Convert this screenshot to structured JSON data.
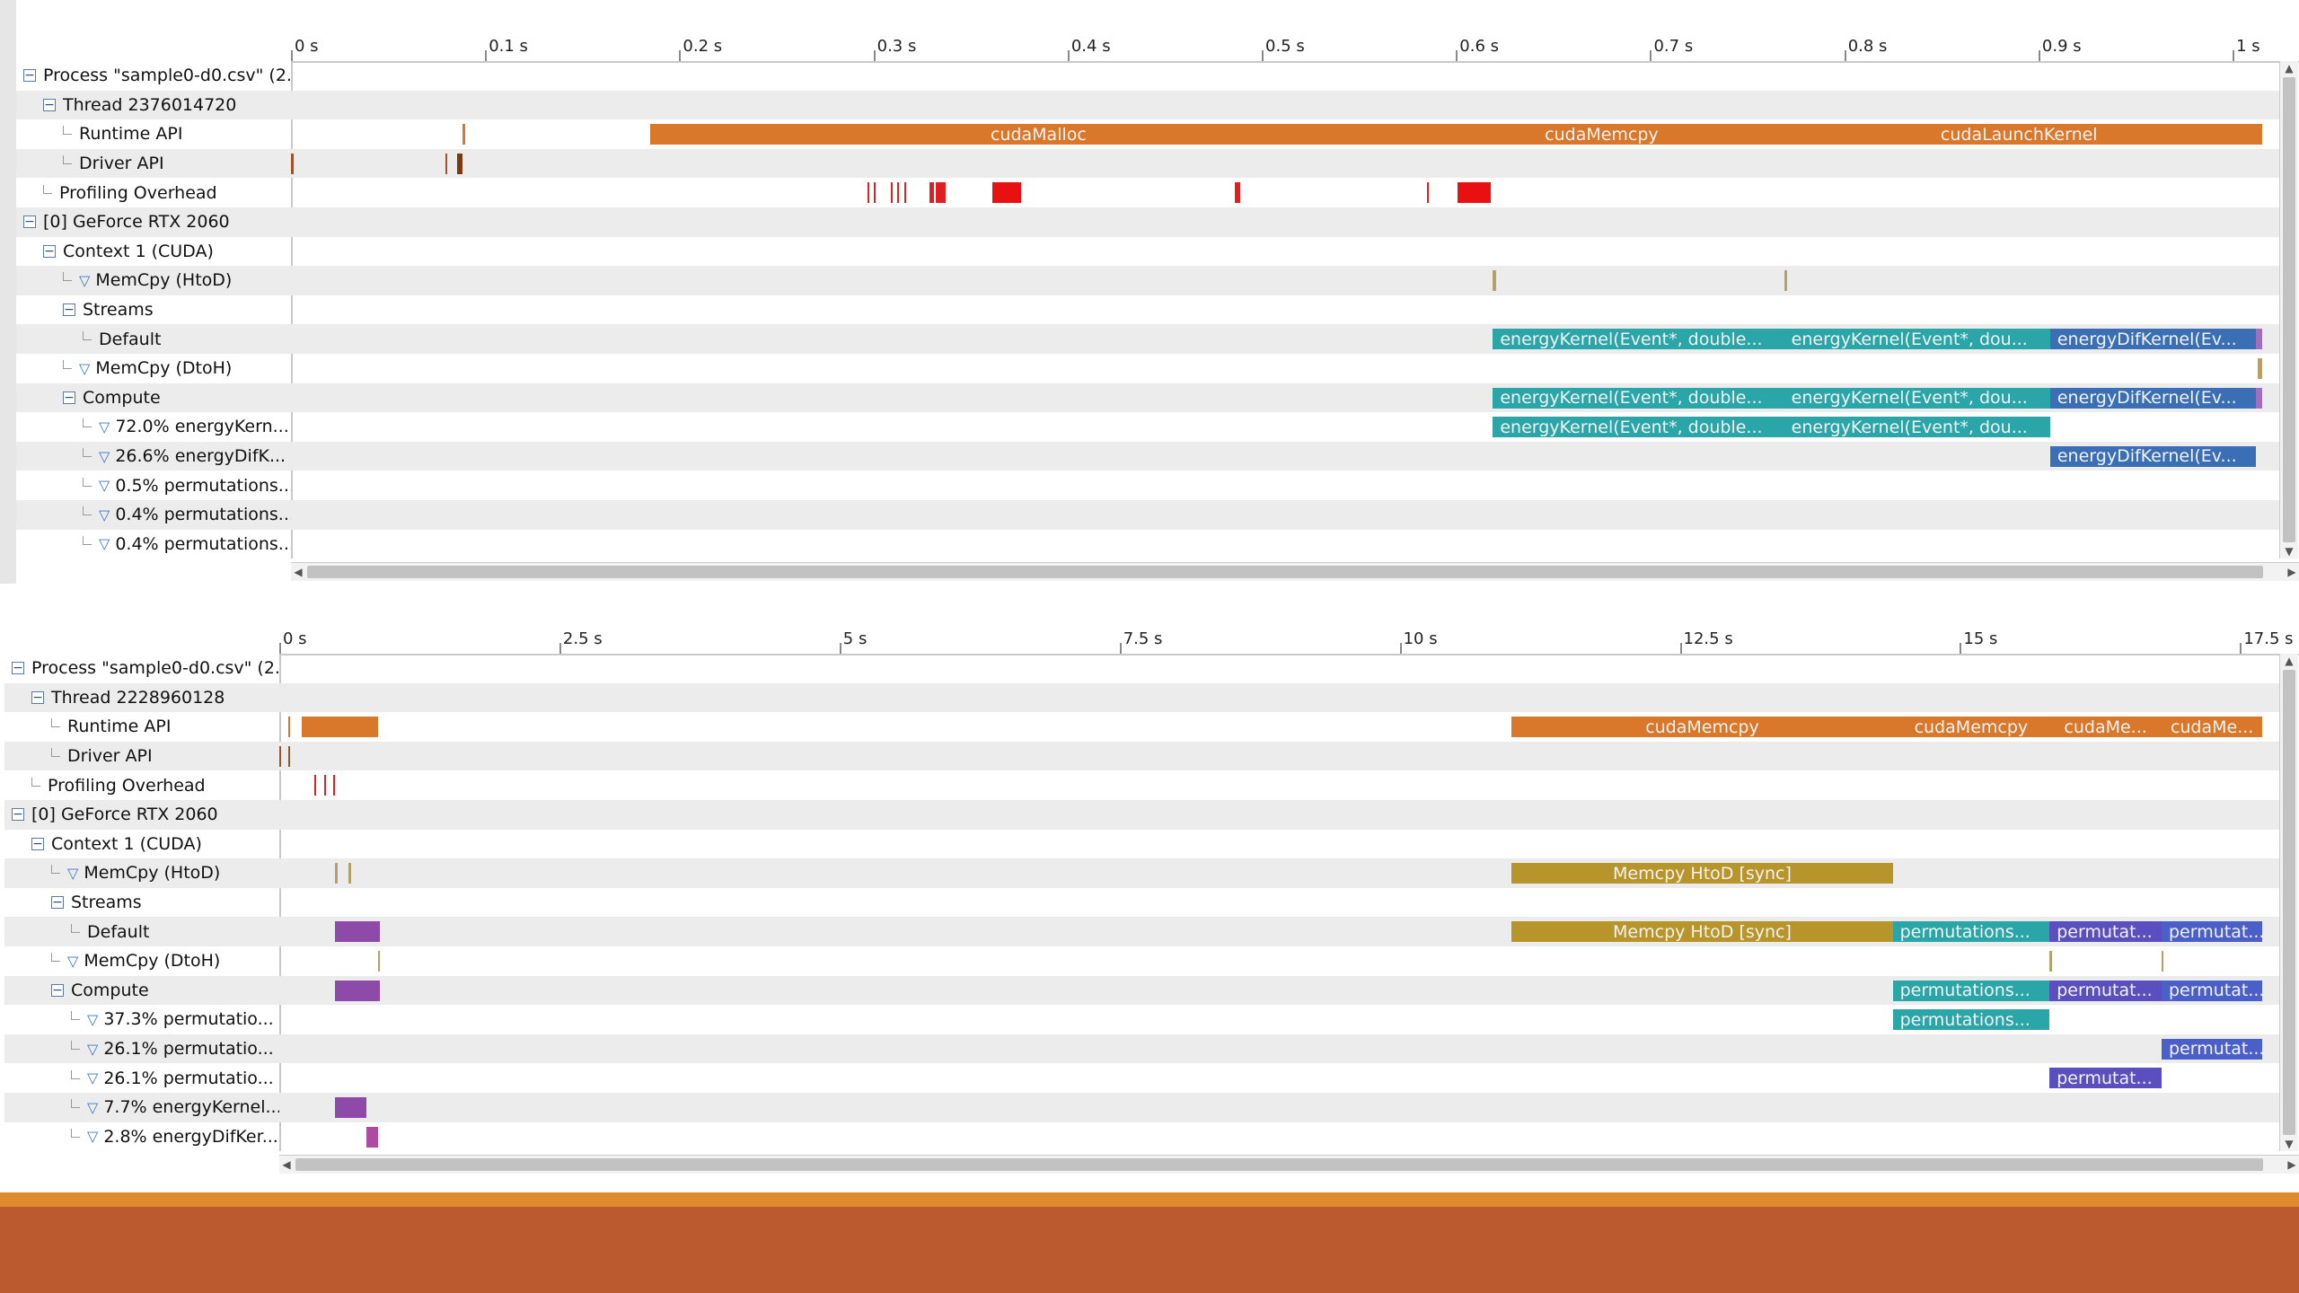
{
  "top_panel": {
    "ticks": [
      "0 s",
      "0.1 s",
      "0.2 s",
      "0.3 s",
      "0.4 s",
      "0.5 s",
      "0.6 s",
      "0.7 s",
      "0.8 s",
      "0.9 s",
      "1 s"
    ],
    "rows": [
      {
        "label": "Process \"sample0-d0.csv\" (2...",
        "indent": 0,
        "kind": "minus"
      },
      {
        "label": "Thread 2376014720",
        "indent": 1,
        "kind": "minus"
      },
      {
        "label": "Runtime API",
        "indent": 2,
        "kind": "leaf"
      },
      {
        "label": "Driver API",
        "indent": 2,
        "kind": "leaf"
      },
      {
        "label": "Profiling Overhead",
        "indent": 1,
        "kind": "leaf"
      },
      {
        "label": "[0] GeForce RTX 2060",
        "indent": 0,
        "kind": "minus"
      },
      {
        "label": "Context 1 (CUDA)",
        "indent": 1,
        "kind": "minus"
      },
      {
        "label": "MemCpy (HtoD)",
        "indent": 2,
        "kind": "filter"
      },
      {
        "label": "Streams",
        "indent": 2,
        "kind": "minus"
      },
      {
        "label": "Default",
        "indent": 3,
        "kind": "leaf"
      },
      {
        "label": "MemCpy (DtoH)",
        "indent": 2,
        "kind": "filter"
      },
      {
        "label": "Compute",
        "indent": 2,
        "kind": "minus"
      },
      {
        "label": "72.0% energyKern...",
        "indent": 3,
        "kind": "filter"
      },
      {
        "label": "26.6% energyDifK...",
        "indent": 3,
        "kind": "filter"
      },
      {
        "label": "0.5% permutations...",
        "indent": 3,
        "kind": "filter"
      },
      {
        "label": "0.4% permutations...",
        "indent": 3,
        "kind": "filter"
      },
      {
        "label": "0.4% permutations...",
        "indent": 3,
        "kind": "filter"
      }
    ],
    "bars": [
      {
        "row": 2,
        "start": 0.185,
        "end": 0.585,
        "label": "cudaMalloc",
        "color": "#d9782a"
      },
      {
        "row": 2,
        "start": 0.585,
        "end": 0.765,
        "label": "cudaMemcpy",
        "color": "#d9782a"
      },
      {
        "row": 2,
        "start": 0.765,
        "end": 1.015,
        "label": "cudaLaunchKernel",
        "color": "#d9782a"
      },
      {
        "row": 2,
        "start": 0.0885,
        "end": 0.0895,
        "label": "",
        "color": "#d9782a"
      },
      {
        "row": 3,
        "start": 0.0,
        "end": 0.0012,
        "label": "",
        "color": "#a0522d"
      },
      {
        "row": 3,
        "start": 0.0795,
        "end": 0.0805,
        "label": "",
        "color": "#a0522d"
      },
      {
        "row": 3,
        "start": 0.0855,
        "end": 0.0885,
        "label": "",
        "color": "#7a3a12"
      },
      {
        "row": 4,
        "start": 0.297,
        "end": 0.298,
        "label": "",
        "color": "#e02020"
      },
      {
        "row": 4,
        "start": 0.3,
        "end": 0.301,
        "label": "",
        "color": "#e02020"
      },
      {
        "row": 4,
        "start": 0.309,
        "end": 0.31,
        "label": "",
        "color": "#e02020"
      },
      {
        "row": 4,
        "start": 0.312,
        "end": 0.313,
        "label": "",
        "color": "#e02020"
      },
      {
        "row": 4,
        "start": 0.316,
        "end": 0.317,
        "label": "",
        "color": "#e02020"
      },
      {
        "row": 4,
        "start": 0.329,
        "end": 0.331,
        "label": "",
        "color": "#e02020"
      },
      {
        "row": 4,
        "start": 0.332,
        "end": 0.337,
        "label": "",
        "color": "#e02020"
      },
      {
        "row": 4,
        "start": 0.361,
        "end": 0.376,
        "label": "",
        "color": "#e81010"
      },
      {
        "row": 4,
        "start": 0.486,
        "end": 0.489,
        "label": "",
        "color": "#e02020"
      },
      {
        "row": 4,
        "start": 0.585,
        "end": 0.586,
        "label": "",
        "color": "#e02020"
      },
      {
        "row": 4,
        "start": 0.601,
        "end": 0.618,
        "label": "",
        "color": "#e81010"
      },
      {
        "row": 7,
        "start": 0.619,
        "end": 0.6205,
        "label": "",
        "color": "#b5a06a"
      },
      {
        "row": 7,
        "start": 0.769,
        "end": 0.7705,
        "label": "",
        "color": "#b5a06a"
      },
      {
        "row": 9,
        "start": 0.619,
        "end": 0.769,
        "label": "energyKernel(Event*, double...",
        "color": "#2ba6a8"
      },
      {
        "row": 9,
        "start": 0.769,
        "end": 0.906,
        "label": "energyKernel(Event*, dou...",
        "color": "#2ba6a8"
      },
      {
        "row": 9,
        "start": 0.906,
        "end": 1.012,
        "label": "energyDifKernel(Ev...",
        "color": "#3a6fb5"
      },
      {
        "row": 9,
        "start": 1.012,
        "end": 1.015,
        "label": "",
        "color": "#a070c0"
      },
      {
        "row": 10,
        "start": 1.013,
        "end": 1.015,
        "label": "",
        "color": "#b5a06a"
      },
      {
        "row": 11,
        "start": 0.619,
        "end": 0.769,
        "label": "energyKernel(Event*, double...",
        "color": "#2ba6a8"
      },
      {
        "row": 11,
        "start": 0.769,
        "end": 0.906,
        "label": "energyKernel(Event*, dou...",
        "color": "#2ba6a8"
      },
      {
        "row": 11,
        "start": 0.906,
        "end": 1.012,
        "label": "energyDifKernel(Ev...",
        "color": "#3a6fb5"
      },
      {
        "row": 11,
        "start": 1.012,
        "end": 1.015,
        "label": "",
        "color": "#a070c0"
      },
      {
        "row": 12,
        "start": 0.619,
        "end": 0.769,
        "label": "energyKernel(Event*, double...",
        "color": "#2ba6a8"
      },
      {
        "row": 12,
        "start": 0.769,
        "end": 0.906,
        "label": "energyKernel(Event*, dou...",
        "color": "#2ba6a8"
      },
      {
        "row": 13,
        "start": 0.906,
        "end": 1.012,
        "label": "energyDifKernel(Ev...",
        "color": "#3a6fb5"
      }
    ]
  },
  "bottom_panel": {
    "ticks": [
      "0 s",
      "2.5 s",
      "5 s",
      "7.5 s",
      "10 s",
      "12.5 s",
      "15 s",
      "17.5 s"
    ],
    "rows": [
      {
        "label": "Process \"sample0-d0.csv\" (2...",
        "indent": 0,
        "kind": "minus"
      },
      {
        "label": "Thread 2228960128",
        "indent": 1,
        "kind": "minus"
      },
      {
        "label": "Runtime API",
        "indent": 2,
        "kind": "leaf"
      },
      {
        "label": "Driver API",
        "indent": 2,
        "kind": "leaf"
      },
      {
        "label": "Profiling Overhead",
        "indent": 1,
        "kind": "leaf"
      },
      {
        "label": "[0] GeForce RTX 2060",
        "indent": 0,
        "kind": "minus"
      },
      {
        "label": "Context 1 (CUDA)",
        "indent": 1,
        "kind": "minus"
      },
      {
        "label": "MemCpy (HtoD)",
        "indent": 2,
        "kind": "filter"
      },
      {
        "label": "Streams",
        "indent": 2,
        "kind": "minus"
      },
      {
        "label": "Default",
        "indent": 3,
        "kind": "leaf"
      },
      {
        "label": "MemCpy (DtoH)",
        "indent": 2,
        "kind": "filter"
      },
      {
        "label": "Compute",
        "indent": 2,
        "kind": "minus"
      },
      {
        "label": "37.3% permutatio...",
        "indent": 3,
        "kind": "filter"
      },
      {
        "label": "26.1% permutatio...",
        "indent": 3,
        "kind": "filter"
      },
      {
        "label": "26.1% permutatio...",
        "indent": 3,
        "kind": "filter"
      },
      {
        "label": "7.7% energyKernel...",
        "indent": 3,
        "kind": "filter"
      },
      {
        "label": "2.8% energyDifKer...",
        "indent": 3,
        "kind": "filter"
      }
    ],
    "bars": [
      {
        "row": 2,
        "start": 0.08,
        "end": 0.1,
        "label": "",
        "color": "#d9782a"
      },
      {
        "row": 2,
        "start": 0.2,
        "end": 0.88,
        "label": "",
        "color": "#d9782a"
      },
      {
        "row": 2,
        "start": 11.0,
        "end": 14.4,
        "label": "cudaMemcpy",
        "color": "#d9782a"
      },
      {
        "row": 2,
        "start": 14.4,
        "end": 15.8,
        "label": "cudaMemcpy",
        "color": "#d9782a"
      },
      {
        "row": 2,
        "start": 15.8,
        "end": 16.8,
        "label": "cudaMe...",
        "color": "#d9782a"
      },
      {
        "row": 2,
        "start": 16.8,
        "end": 17.7,
        "label": "cudaMe...",
        "color": "#d9782a"
      },
      {
        "row": 3,
        "start": 0.0,
        "end": 0.02,
        "label": "",
        "color": "#a0522d"
      },
      {
        "row": 3,
        "start": 0.08,
        "end": 0.1,
        "label": "",
        "color": "#a0522d"
      },
      {
        "row": 4,
        "start": 0.31,
        "end": 0.33,
        "label": "",
        "color": "#e02020"
      },
      {
        "row": 4,
        "start": 0.4,
        "end": 0.42,
        "label": "",
        "color": "#e02020"
      },
      {
        "row": 4,
        "start": 0.48,
        "end": 0.5,
        "label": "",
        "color": "#e02020"
      },
      {
        "row": 7,
        "start": 0.5,
        "end": 0.52,
        "label": "",
        "color": "#b5a06a"
      },
      {
        "row": 7,
        "start": 0.62,
        "end": 0.64,
        "label": "",
        "color": "#b5a06a"
      },
      {
        "row": 7,
        "start": 11.0,
        "end": 14.4,
        "label": "Memcpy HtoD [sync]",
        "color": "#b8952a"
      },
      {
        "row": 9,
        "start": 0.5,
        "end": 0.9,
        "label": "",
        "color": "#8e4aa8"
      },
      {
        "row": 9,
        "start": 11.0,
        "end": 14.4,
        "label": "Memcpy HtoD [sync]",
        "color": "#b8952a"
      },
      {
        "row": 9,
        "start": 14.4,
        "end": 15.8,
        "label": "permutations...",
        "color": "#2ba6a8"
      },
      {
        "row": 9,
        "start": 15.8,
        "end": 16.8,
        "label": "permutat...",
        "color": "#5b4fc0"
      },
      {
        "row": 9,
        "start": 16.8,
        "end": 17.7,
        "label": "permutat...",
        "color": "#4b5fc8"
      },
      {
        "row": 10,
        "start": 0.88,
        "end": 0.9,
        "label": "",
        "color": "#b5a06a"
      },
      {
        "row": 10,
        "start": 15.8,
        "end": 15.82,
        "label": "",
        "color": "#b5a06a"
      },
      {
        "row": 10,
        "start": 16.8,
        "end": 16.82,
        "label": "",
        "color": "#b5a06a"
      },
      {
        "row": 11,
        "start": 0.5,
        "end": 0.9,
        "label": "",
        "color": "#8e4aa8"
      },
      {
        "row": 11,
        "start": 14.4,
        "end": 15.8,
        "label": "permutations...",
        "color": "#2ba6a8"
      },
      {
        "row": 11,
        "start": 15.8,
        "end": 16.8,
        "label": "permutat...",
        "color": "#5b4fc0"
      },
      {
        "row": 11,
        "start": 16.8,
        "end": 17.7,
        "label": "permutat...",
        "color": "#4b5fc8"
      },
      {
        "row": 12,
        "start": 14.4,
        "end": 15.8,
        "label": "permutations...",
        "color": "#2ba6a8"
      },
      {
        "row": 13,
        "start": 16.8,
        "end": 17.7,
        "label": "permutat...",
        "color": "#4b5fc8"
      },
      {
        "row": 14,
        "start": 15.8,
        "end": 16.8,
        "label": "permutat...",
        "color": "#5b4fc0"
      },
      {
        "row": 15,
        "start": 0.5,
        "end": 0.78,
        "label": "",
        "color": "#8e4aa8"
      },
      {
        "row": 16,
        "start": 0.78,
        "end": 0.88,
        "label": "",
        "color": "#b04aa0"
      }
    ]
  }
}
